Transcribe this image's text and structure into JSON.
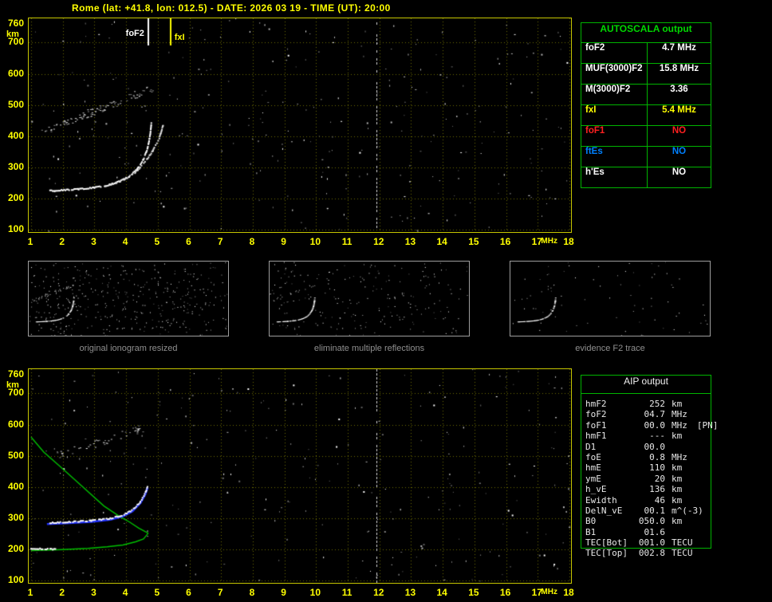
{
  "title": "Rome (lat: +41.8, lon: 012.5) - DATE: 2026 03 19 - TIME (UT): 20:00",
  "colors": {
    "axis": "#ffff00",
    "plot_border": "#c6c600",
    "grid": "#6e6e00",
    "table_green": "#00b400",
    "autoscala_header": "#00d800",
    "fof1_red": "#ff2020",
    "ftes_blue": "#0080ff",
    "fxi_yellow": "#ffff00",
    "profile_green": "#00c000",
    "restored_blue": "#2233ff"
  },
  "ionogram_top": {
    "y_unit": "km",
    "x_unit": "MHz",
    "y_ticks": [
      760,
      700,
      600,
      500,
      400,
      300,
      200,
      100
    ],
    "x_ticks": [
      1,
      2,
      3,
      4,
      5,
      6,
      7,
      8,
      9,
      10,
      11,
      12,
      13,
      14,
      15,
      16,
      17,
      18
    ],
    "markers": [
      {
        "label": "foF2",
        "freq": 4.7,
        "color": "#ffffff"
      },
      {
        "label": "fxI",
        "freq": 5.4,
        "color": "#ffff00"
      }
    ],
    "noise_count": 290,
    "rfi_lines": [
      11.9
    ],
    "traces": [
      {
        "name": "F2-ordinary",
        "color": "#ffffff",
        "points": [
          [
            1.6,
            226
          ],
          [
            2.0,
            228
          ],
          [
            2.5,
            231
          ],
          [
            3.0,
            236
          ],
          [
            3.4,
            243
          ],
          [
            3.8,
            256
          ],
          [
            4.1,
            272
          ],
          [
            4.35,
            295
          ],
          [
            4.55,
            327
          ],
          [
            4.68,
            362
          ],
          [
            4.76,
            405
          ],
          [
            4.8,
            445
          ]
        ]
      },
      {
        "name": "F2-extraordinary",
        "color": "#e0e0e0",
        "points": [
          [
            3.35,
            242
          ],
          [
            3.7,
            252
          ],
          [
            4.0,
            265
          ],
          [
            4.3,
            285
          ],
          [
            4.6,
            318
          ],
          [
            4.85,
            355
          ],
          [
            5.05,
            395
          ],
          [
            5.18,
            440
          ]
        ]
      }
    ],
    "scatter_bands": [
      {
        "from": [
          1.35,
          415
        ],
        "to": [
          4.85,
          555
        ],
        "density": 110
      }
    ]
  },
  "autoscala": {
    "header": "AUTOSCALA output",
    "rows": [
      {
        "param": "foF2",
        "value": "4.7 MHz",
        "color": "#ffffff"
      },
      {
        "param": "MUF(3000)F2",
        "value": "15.8 MHz",
        "color": "#ffffff"
      },
      {
        "param": "M(3000)F2",
        "value": "3.36",
        "color": "#ffffff"
      },
      {
        "param": "fxI",
        "value": "5.4 MHz",
        "color": "#ffff00"
      },
      {
        "param": "foF1",
        "value": "NO",
        "color": "#ff2020"
      },
      {
        "param": "ftEs",
        "value": "NO",
        "color": "#0080ff"
      },
      {
        "param": "h'Es",
        "value": "NO",
        "color": "#ffffff"
      }
    ]
  },
  "thumbnails": [
    {
      "caption": "original ionogram resized",
      "noise_count": 420,
      "band_density": 35
    },
    {
      "caption": "eliminate multiple reflections",
      "noise_count": 220,
      "band_density": 18
    },
    {
      "caption": "evidence F2 trace",
      "noise_count": 70,
      "band_density": 8
    }
  ],
  "ionogram_bottom": {
    "y_unit": "km",
    "x_unit": "MHz",
    "y_ticks": [
      760,
      700,
      600,
      500,
      400,
      300,
      200,
      100
    ],
    "x_ticks": [
      1,
      2,
      3,
      4,
      5,
      6,
      7,
      8,
      9,
      10,
      11,
      12,
      13,
      14,
      15,
      16,
      17,
      18
    ],
    "noise_count": 260,
    "rfi_lines": [
      11.9
    ],
    "traces": [
      {
        "name": "F2-trace",
        "color": "#ffffff",
        "points": [
          [
            1.6,
            286
          ],
          [
            2.2,
            289
          ],
          [
            2.9,
            293
          ],
          [
            3.5,
            300
          ],
          [
            3.9,
            311
          ],
          [
            4.2,
            327
          ],
          [
            4.45,
            353
          ],
          [
            4.6,
            380
          ],
          [
            4.68,
            402
          ]
        ]
      },
      {
        "name": "E-trace",
        "color": "#ffffff",
        "points": [
          [
            1.0,
            204
          ],
          [
            1.8,
            201
          ]
        ]
      }
    ],
    "restored_trace": {
      "color": "#2233ff",
      "points": [
        [
          1.5,
          281
        ],
        [
          2.2,
          284
        ],
        [
          2.9,
          288
        ],
        [
          3.5,
          295
        ],
        [
          3.9,
          306
        ],
        [
          4.2,
          322
        ],
        [
          4.45,
          348
        ],
        [
          4.6,
          375
        ],
        [
          4.68,
          398
        ]
      ]
    },
    "profile": {
      "color": "#00c000",
      "topside": [
        [
          1.0,
          560
        ],
        [
          1.4,
          512
        ],
        [
          1.9,
          467
        ],
        [
          2.6,
          403
        ],
        [
          3.3,
          339
        ],
        [
          3.8,
          305
        ],
        [
          4.1,
          288
        ],
        [
          4.4,
          268
        ],
        [
          4.6,
          257
        ],
        [
          4.7,
          252
        ]
      ],
      "bottomside": [
        [
          4.7,
          252
        ],
        [
          4.55,
          233
        ],
        [
          4.3,
          224
        ],
        [
          3.9,
          214
        ],
        [
          3.4,
          208
        ],
        [
          2.8,
          203
        ],
        [
          2.0,
          199
        ],
        [
          1.0,
          196
        ]
      ]
    },
    "scatter_bands": [
      {
        "from": [
          1.8,
          500
        ],
        "to": [
          4.5,
          590
        ],
        "density": 45
      }
    ]
  },
  "aip": {
    "header": "AIP output",
    "rows": [
      {
        "param": "hmF2",
        "value": "252",
        "unit": "km",
        "note": ""
      },
      {
        "param": "foF2",
        "value": "04.7",
        "unit": "MHz",
        "note": ""
      },
      {
        "param": "foF1",
        "value": "00.0",
        "unit": "MHz",
        "note": "[PN]"
      },
      {
        "param": "hmF1",
        "value": "---",
        "unit": "km",
        "note": ""
      },
      {
        "param": "D1",
        "value": "00.0",
        "unit": "",
        "note": ""
      },
      {
        "param": "foE",
        "value": "0.8",
        "unit": "MHz",
        "note": ""
      },
      {
        "param": "hmE",
        "value": "110",
        "unit": "km",
        "note": ""
      },
      {
        "param": "ymE",
        "value": "20",
        "unit": "km",
        "note": ""
      },
      {
        "param": "h_vE",
        "value": "136",
        "unit": "km",
        "note": ""
      },
      {
        "param": "Ewidth",
        "value": "46",
        "unit": "km",
        "note": ""
      },
      {
        "param": "DelN_vE",
        "value": "00.1",
        "unit": "m^(-3)",
        "note": ""
      },
      {
        "param": "B0",
        "value": "050.0",
        "unit": "km",
        "note": ""
      },
      {
        "param": "B1",
        "value": "01.6",
        "unit": "",
        "note": ""
      },
      {
        "param": "TEC[Bot]",
        "value": "001.0",
        "unit": "TECU",
        "note": ""
      },
      {
        "param": "TEC[Top]",
        "value": "002.8",
        "unit": "TECU",
        "note": ""
      }
    ]
  }
}
